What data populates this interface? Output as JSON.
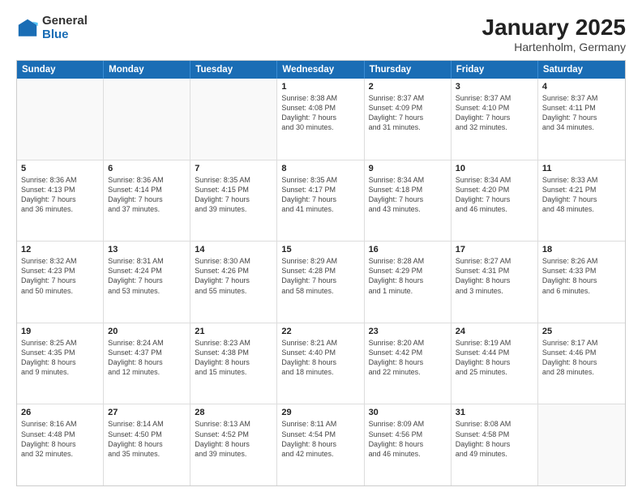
{
  "logo": {
    "general": "General",
    "blue": "Blue"
  },
  "title": "January 2025",
  "location": "Hartenholm, Germany",
  "days": [
    "Sunday",
    "Monday",
    "Tuesday",
    "Wednesday",
    "Thursday",
    "Friday",
    "Saturday"
  ],
  "weeks": [
    [
      {
        "day": "",
        "info": ""
      },
      {
        "day": "",
        "info": ""
      },
      {
        "day": "",
        "info": ""
      },
      {
        "day": "1",
        "info": "Sunrise: 8:38 AM\nSunset: 4:08 PM\nDaylight: 7 hours\nand 30 minutes."
      },
      {
        "day": "2",
        "info": "Sunrise: 8:37 AM\nSunset: 4:09 PM\nDaylight: 7 hours\nand 31 minutes."
      },
      {
        "day": "3",
        "info": "Sunrise: 8:37 AM\nSunset: 4:10 PM\nDaylight: 7 hours\nand 32 minutes."
      },
      {
        "day": "4",
        "info": "Sunrise: 8:37 AM\nSunset: 4:11 PM\nDaylight: 7 hours\nand 34 minutes."
      }
    ],
    [
      {
        "day": "5",
        "info": "Sunrise: 8:36 AM\nSunset: 4:13 PM\nDaylight: 7 hours\nand 36 minutes."
      },
      {
        "day": "6",
        "info": "Sunrise: 8:36 AM\nSunset: 4:14 PM\nDaylight: 7 hours\nand 37 minutes."
      },
      {
        "day": "7",
        "info": "Sunrise: 8:35 AM\nSunset: 4:15 PM\nDaylight: 7 hours\nand 39 minutes."
      },
      {
        "day": "8",
        "info": "Sunrise: 8:35 AM\nSunset: 4:17 PM\nDaylight: 7 hours\nand 41 minutes."
      },
      {
        "day": "9",
        "info": "Sunrise: 8:34 AM\nSunset: 4:18 PM\nDaylight: 7 hours\nand 43 minutes."
      },
      {
        "day": "10",
        "info": "Sunrise: 8:34 AM\nSunset: 4:20 PM\nDaylight: 7 hours\nand 46 minutes."
      },
      {
        "day": "11",
        "info": "Sunrise: 8:33 AM\nSunset: 4:21 PM\nDaylight: 7 hours\nand 48 minutes."
      }
    ],
    [
      {
        "day": "12",
        "info": "Sunrise: 8:32 AM\nSunset: 4:23 PM\nDaylight: 7 hours\nand 50 minutes."
      },
      {
        "day": "13",
        "info": "Sunrise: 8:31 AM\nSunset: 4:24 PM\nDaylight: 7 hours\nand 53 minutes."
      },
      {
        "day": "14",
        "info": "Sunrise: 8:30 AM\nSunset: 4:26 PM\nDaylight: 7 hours\nand 55 minutes."
      },
      {
        "day": "15",
        "info": "Sunrise: 8:29 AM\nSunset: 4:28 PM\nDaylight: 7 hours\nand 58 minutes."
      },
      {
        "day": "16",
        "info": "Sunrise: 8:28 AM\nSunset: 4:29 PM\nDaylight: 8 hours\nand 1 minute."
      },
      {
        "day": "17",
        "info": "Sunrise: 8:27 AM\nSunset: 4:31 PM\nDaylight: 8 hours\nand 3 minutes."
      },
      {
        "day": "18",
        "info": "Sunrise: 8:26 AM\nSunset: 4:33 PM\nDaylight: 8 hours\nand 6 minutes."
      }
    ],
    [
      {
        "day": "19",
        "info": "Sunrise: 8:25 AM\nSunset: 4:35 PM\nDaylight: 8 hours\nand 9 minutes."
      },
      {
        "day": "20",
        "info": "Sunrise: 8:24 AM\nSunset: 4:37 PM\nDaylight: 8 hours\nand 12 minutes."
      },
      {
        "day": "21",
        "info": "Sunrise: 8:23 AM\nSunset: 4:38 PM\nDaylight: 8 hours\nand 15 minutes."
      },
      {
        "day": "22",
        "info": "Sunrise: 8:21 AM\nSunset: 4:40 PM\nDaylight: 8 hours\nand 18 minutes."
      },
      {
        "day": "23",
        "info": "Sunrise: 8:20 AM\nSunset: 4:42 PM\nDaylight: 8 hours\nand 22 minutes."
      },
      {
        "day": "24",
        "info": "Sunrise: 8:19 AM\nSunset: 4:44 PM\nDaylight: 8 hours\nand 25 minutes."
      },
      {
        "day": "25",
        "info": "Sunrise: 8:17 AM\nSunset: 4:46 PM\nDaylight: 8 hours\nand 28 minutes."
      }
    ],
    [
      {
        "day": "26",
        "info": "Sunrise: 8:16 AM\nSunset: 4:48 PM\nDaylight: 8 hours\nand 32 minutes."
      },
      {
        "day": "27",
        "info": "Sunrise: 8:14 AM\nSunset: 4:50 PM\nDaylight: 8 hours\nand 35 minutes."
      },
      {
        "day": "28",
        "info": "Sunrise: 8:13 AM\nSunset: 4:52 PM\nDaylight: 8 hours\nand 39 minutes."
      },
      {
        "day": "29",
        "info": "Sunrise: 8:11 AM\nSunset: 4:54 PM\nDaylight: 8 hours\nand 42 minutes."
      },
      {
        "day": "30",
        "info": "Sunrise: 8:09 AM\nSunset: 4:56 PM\nDaylight: 8 hours\nand 46 minutes."
      },
      {
        "day": "31",
        "info": "Sunrise: 8:08 AM\nSunset: 4:58 PM\nDaylight: 8 hours\nand 49 minutes."
      },
      {
        "day": "",
        "info": ""
      }
    ]
  ]
}
